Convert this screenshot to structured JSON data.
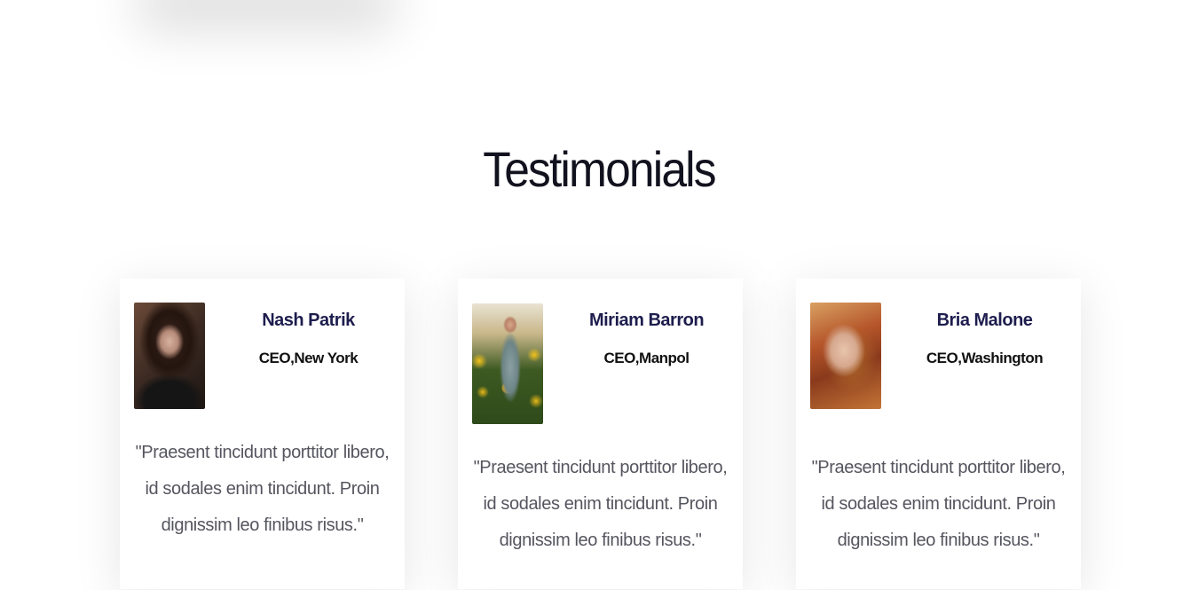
{
  "section": {
    "title": "Testimonials"
  },
  "testimonials": [
    {
      "name": "Nash Patrik",
      "role": "CEO,New York",
      "quote": "\"Praesent tincidunt porttitor libero, id sodales enim tincidunt. Proin dignissim leo finibus risus.\""
    },
    {
      "name": "Miriam Barron",
      "role": "CEO,Manpol",
      "quote": "\"Praesent tincidunt porttitor libero, id sodales enim tincidunt. Proin dignissim leo finibus risus.\""
    },
    {
      "name": "Bria Malone",
      "role": "CEO,Washington",
      "quote": "\"Praesent tincidunt porttitor libero, id sodales enim tincidunt. Proin dignissim leo finibus risus.\""
    }
  ],
  "colors": {
    "name": "#1d1d4e",
    "role": "#111111",
    "quote": "#55555f",
    "title": "#12121f"
  }
}
